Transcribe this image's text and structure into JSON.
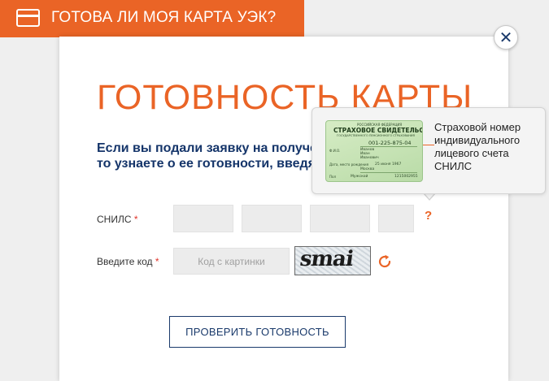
{
  "banner": {
    "icon": "card-icon",
    "title": "ГОТОВА ЛИ МОЯ КАРТА УЭК?",
    "color": "#ea6426"
  },
  "modal": {
    "close_icon": "close-icon",
    "title": "ГОТОВНОСТЬ КАРТЫ",
    "intro_lines": [
      "Если вы подали заявку на получение карты,",
      "то узнаете о ее готовности, введя СНИЛС"
    ]
  },
  "form": {
    "snils_label": "СНИЛС",
    "required_mark": "*",
    "snils_boxes": [
      "",
      "",
      "",
      ""
    ],
    "help_mark": "?",
    "captcha_label": "Введите код",
    "captcha_placeholder": "Код с картинки",
    "captcha_text": "smai",
    "refresh_icon": "refresh-icon",
    "submit_label": "ПРОВЕРИТЬ ГОТОВНОСТЬ"
  },
  "tooltip": {
    "lines": [
      "Страховой номер",
      "индивидуального",
      "лицевого счета",
      "СНИЛС"
    ],
    "card": {
      "header_small": "РОССИЙСКАЯ ФЕДЕРАЦИЯ",
      "header_title": "СТРАХОВОЕ СВИДЕТЕЛЬСТВО",
      "header_sub": "ГОСУДАРСТВЕННОГО ПЕНСИОННОГО СТРАХОВАНИЯ",
      "number": "001-225-875-04",
      "fio_label": "Ф.И.О.",
      "fio": [
        "Иванов",
        "Иван",
        "Иванович"
      ],
      "birth_label": "Дата, место рождения",
      "birth_date": "25 июня 1967",
      "birth_place": "Москва",
      "sex_label": "Пол",
      "sex": "Мужской",
      "issued": "1215002955"
    }
  }
}
